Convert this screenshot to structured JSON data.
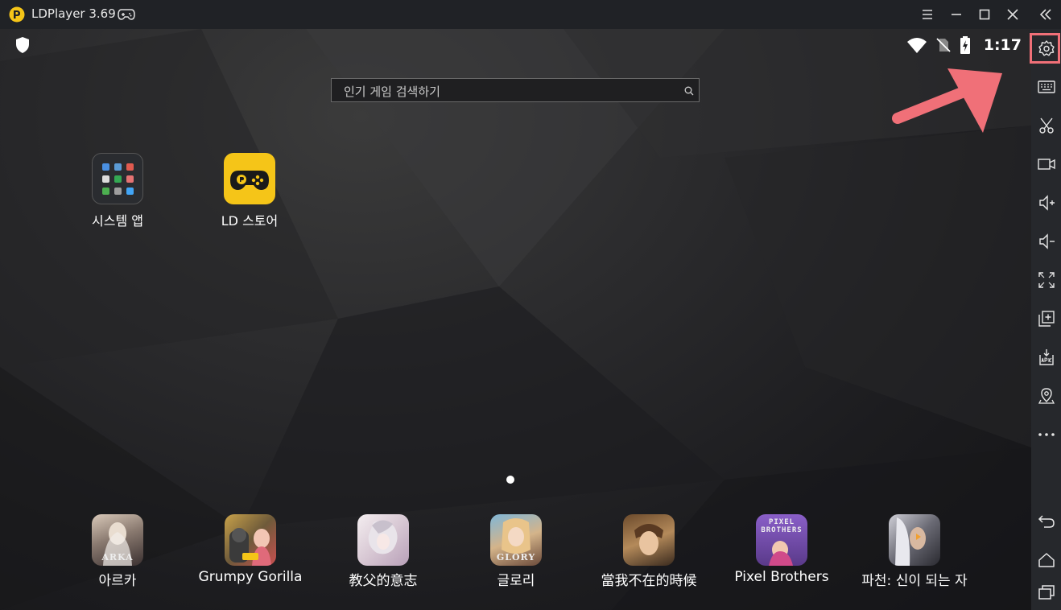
{
  "window": {
    "title": "LDPlayer 3.69"
  },
  "status_bar": {
    "time": "1:17"
  },
  "search": {
    "placeholder": "인기 게임 검색하기"
  },
  "desktop_apps": [
    {
      "label": "시스템 앱",
      "icon": "system-apps-folder-icon"
    },
    {
      "label": "LD 스토어",
      "icon": "ld-store-icon"
    }
  ],
  "dock_apps": [
    {
      "label": "아르카",
      "art_text": "ARKA"
    },
    {
      "label": "Grumpy Gorilla",
      "art_text": ""
    },
    {
      "label": "教父的意志",
      "art_text": ""
    },
    {
      "label": "글로리",
      "art_text": "GLORY"
    },
    {
      "label": "當我不在的時候",
      "art_text": ""
    },
    {
      "label": "Pixel Brothers",
      "art_text": "PIXEL BROTHERS"
    },
    {
      "label": "파천: 신이 되는 자",
      "art_text": ""
    }
  ],
  "sidebar": {
    "items": [
      "settings-icon",
      "keyboard-icon",
      "scissors-icon",
      "video-record-icon",
      "volume-up-icon",
      "volume-down-icon",
      "fullscreen-icon",
      "multi-instance-icon",
      "apk-install-icon",
      "location-icon",
      "more-icon"
    ],
    "nav": [
      "back-icon",
      "home-icon",
      "recents-icon"
    ],
    "highlighted": "settings-icon"
  },
  "colors": {
    "accent_yellow": "#f5c518",
    "highlight": "#f07078"
  }
}
